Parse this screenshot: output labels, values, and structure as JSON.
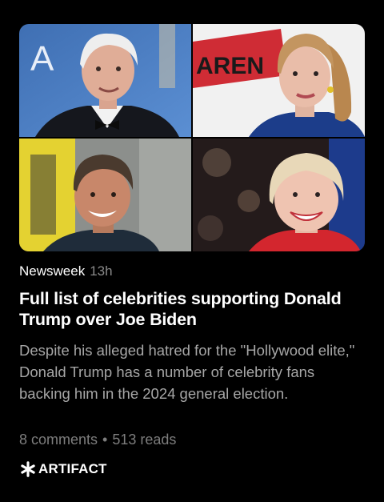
{
  "article": {
    "image_tiles": [
      {
        "subject": "man-in-tuxedo",
        "background_text": "A"
      },
      {
        "subject": "woman-with-ponytail",
        "background_text": "AREN"
      },
      {
        "subject": "smiling-man",
        "background_text": ""
      },
      {
        "subject": "smiling-woman",
        "background_text": ""
      }
    ],
    "source": "Newsweek",
    "age": "13h",
    "headline": "Full list of celebrities supporting Donald Trump over Joe Biden",
    "summary": "Despite his alleged hatred for the \"Hollywood elite,\" Donald Trump has a number of celebrity fans backing him in the 2024 general election.",
    "comments": "8 comments",
    "separator": "•",
    "reads": "513 reads"
  },
  "brand": {
    "icon": "asterisk-logo-icon",
    "name": "ARTIFACT"
  },
  "colors": {
    "background": "#000000",
    "text_primary": "#ffffff",
    "text_secondary": "#a6a6a6",
    "text_muted": "#7d7d7d"
  }
}
